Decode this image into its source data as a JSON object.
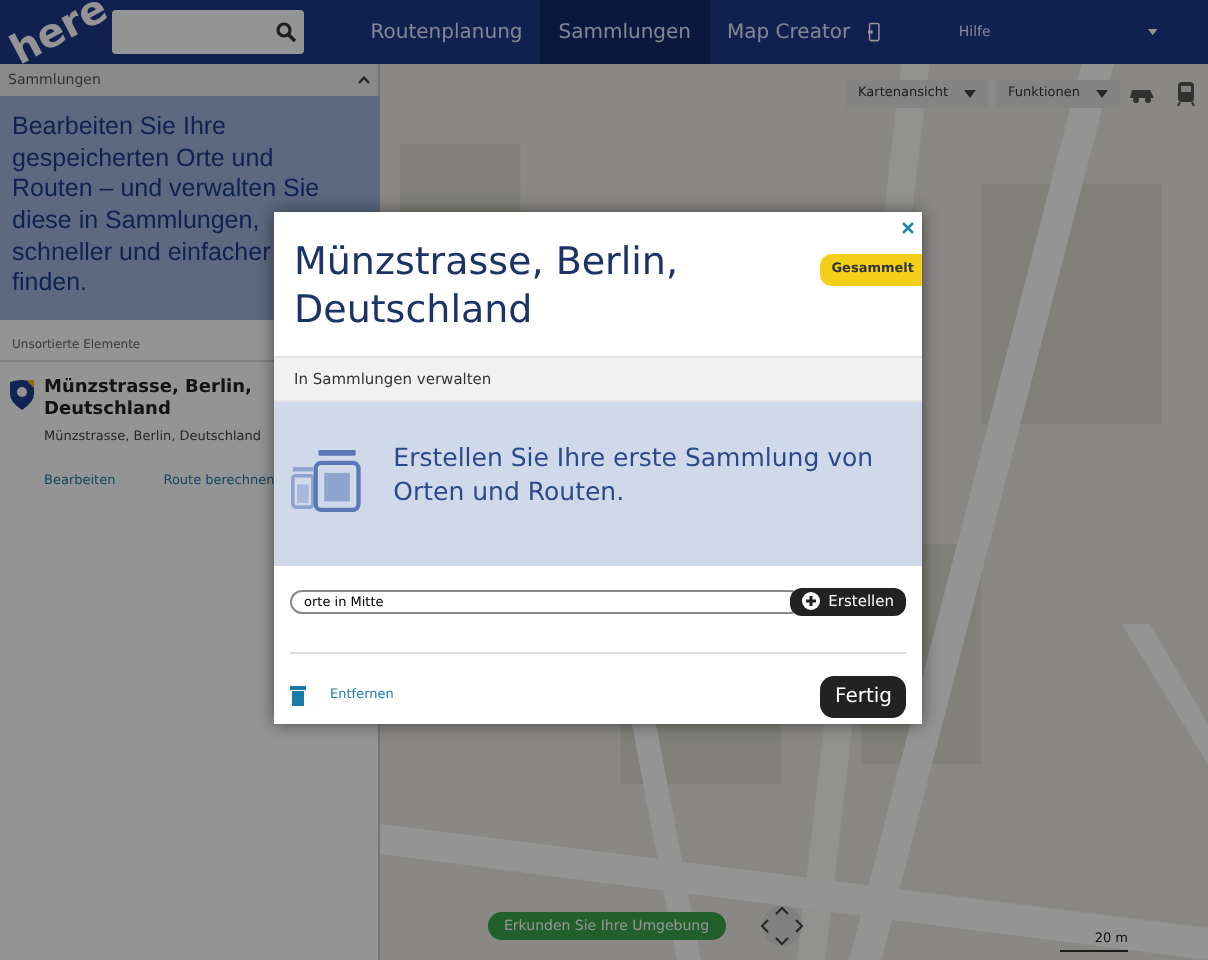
{
  "navbar": {
    "logo": "here",
    "tabs": [
      {
        "label": "Routenplanung",
        "selected": false
      },
      {
        "label": "Sammlungen",
        "selected": true
      },
      {
        "label": "Map Creator",
        "selected": false
      }
    ],
    "help": "Hilfe"
  },
  "sidebar": {
    "header": "Sammlungen",
    "intro": "Bearbeiten Sie Ihre gespeicherten Orte und Routen – und verwalten Sie diese in Sammlungen, schneller und einfacher finden.",
    "section": "Unsortierte Elemente",
    "item": {
      "title": "Münzstrasse, Berlin, Deutschland",
      "subtitle": "Münzstrasse, Berlin, Deutschland",
      "actions": [
        "Bearbeiten",
        "Route berechnen"
      ]
    }
  },
  "map": {
    "kind": "picture",
    "controls": [
      "Kartenansicht",
      "Funktionen"
    ],
    "explore": "Erkunden Sie Ihre Umgebung",
    "scale": "20 m"
  },
  "dialog": {
    "title": "Münzstrasse, Berlin, Deutschland",
    "badge": "Gesammelt",
    "section": "In Sammlungen verwalten",
    "promo": "Erstellen Sie Ihre erste Sammlung von Orten und Routen.",
    "input": {
      "value": "orte in Mitte"
    },
    "create": "Erstellen",
    "remove": "Entfernen",
    "done": "Fertig"
  }
}
